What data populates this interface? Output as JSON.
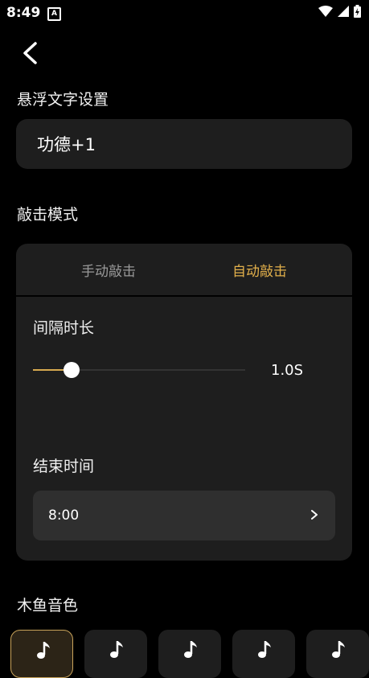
{
  "status_bar": {
    "time": "8:49",
    "notif_letter": "A"
  },
  "float_text": {
    "section_title": "悬浮文字设置",
    "value": "功德+1"
  },
  "tap_mode": {
    "section_title": "敲击模式",
    "tabs": [
      {
        "label": "手动敲击",
        "active": false
      },
      {
        "label": "自动敲击",
        "active": true
      }
    ],
    "interval": {
      "label": "间隔时长",
      "value_text": "1.0S",
      "slider_fraction": 0.11
    },
    "end_time": {
      "label": "结束时间",
      "value": "8:00"
    }
  },
  "sound": {
    "section_title": "木鱼音色",
    "options": [
      {
        "icon": "music-note-icon",
        "selected": true
      },
      {
        "icon": "music-note-icon",
        "selected": false
      },
      {
        "icon": "music-note-icon",
        "selected": false
      },
      {
        "icon": "music-note-icon",
        "selected": false
      },
      {
        "icon": "music-note-icon",
        "selected": false
      }
    ]
  },
  "colors": {
    "accent": "#e3b04b",
    "card": "#1e1e1e",
    "background": "#000000"
  }
}
